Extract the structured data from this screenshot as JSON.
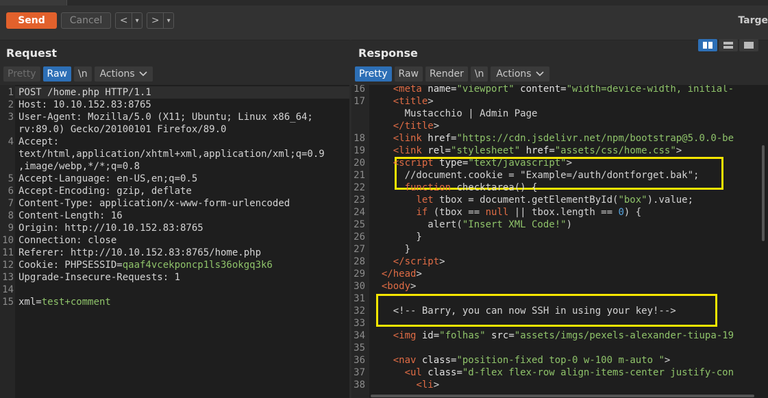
{
  "toolbar": {
    "send_label": "Send",
    "cancel_label": "Cancel",
    "back_glyph": "<",
    "forward_glyph": ">",
    "dropdown_glyph": "▾",
    "target_label": "Targe"
  },
  "request": {
    "title": "Request",
    "tabs": [
      {
        "label": "Pretty",
        "state": "disabled"
      },
      {
        "label": "Raw",
        "state": "selected"
      },
      {
        "label": "\\n",
        "state": "normal"
      },
      {
        "label": "Actions",
        "state": "dropdown"
      }
    ],
    "lines": [
      {
        "num": "1",
        "parts": [
          [
            "plain",
            "POST /home.php HTTP/1.1"
          ]
        ]
      },
      {
        "num": "2",
        "parts": [
          [
            "plain",
            "Host: 10.10.152.83:8765"
          ]
        ]
      },
      {
        "num": "3",
        "parts": [
          [
            "plain",
            "User-Agent: Mozilla/5.0 (X11; Ubuntu; Linux x86_64;"
          ]
        ]
      },
      {
        "num": "",
        "parts": [
          [
            "plain",
            "rv:89.0) Gecko/20100101 Firefox/89.0"
          ]
        ]
      },
      {
        "num": "4",
        "parts": [
          [
            "plain",
            "Accept:"
          ]
        ]
      },
      {
        "num": "",
        "parts": [
          [
            "plain",
            "text/html,application/xhtml+xml,application/xml;q=0.9"
          ]
        ]
      },
      {
        "num": "",
        "parts": [
          [
            "plain",
            ",image/webp,*/*;q=0.8"
          ]
        ]
      },
      {
        "num": "5",
        "parts": [
          [
            "plain",
            "Accept-Language: en-US,en;q=0.5"
          ]
        ]
      },
      {
        "num": "6",
        "parts": [
          [
            "plain",
            "Accept-Encoding: gzip, deflate"
          ]
        ]
      },
      {
        "num": "7",
        "parts": [
          [
            "plain",
            "Content-Type: application/x-www-form-urlencoded"
          ]
        ]
      },
      {
        "num": "8",
        "parts": [
          [
            "plain",
            "Content-Length: 16"
          ]
        ]
      },
      {
        "num": "9",
        "parts": [
          [
            "plain",
            "Origin: http://10.10.152.83:8765"
          ]
        ]
      },
      {
        "num": "10",
        "parts": [
          [
            "plain",
            "Connection: close"
          ]
        ]
      },
      {
        "num": "11",
        "parts": [
          [
            "plain",
            "Referer: http://10.10.152.83:8765/home.php"
          ]
        ]
      },
      {
        "num": "12",
        "parts": [
          [
            "plain",
            "Cookie: PHPSESSID="
          ],
          [
            "val",
            "qaaf4vcekponcp1ls36okgq3k6"
          ]
        ]
      },
      {
        "num": "13",
        "parts": [
          [
            "plain",
            "Upgrade-Insecure-Requests: 1"
          ]
        ]
      },
      {
        "num": "14",
        "parts": [
          [
            "plain",
            ""
          ]
        ]
      },
      {
        "num": "15",
        "parts": [
          [
            "plain",
            "xml="
          ],
          [
            "val",
            "test+comment"
          ]
        ]
      }
    ]
  },
  "response": {
    "title": "Response",
    "tabs": [
      {
        "label": "Pretty",
        "state": "selected"
      },
      {
        "label": "Raw",
        "state": "normal"
      },
      {
        "label": "Render",
        "state": "normal"
      },
      {
        "label": "\\n",
        "state": "normal"
      },
      {
        "label": "Actions",
        "state": "dropdown"
      }
    ],
    "lines": [
      {
        "num": "16",
        "parts": [
          [
            "plain",
            "    "
          ],
          [
            "tag",
            "<meta "
          ],
          [
            "attr",
            "name="
          ],
          [
            "str",
            "\"viewport\""
          ],
          [
            "attr",
            " content="
          ],
          [
            "str",
            "\"width=device-width, initial-"
          ]
        ]
      },
      {
        "num": "17",
        "parts": [
          [
            "plain",
            "    "
          ],
          [
            "tag",
            "<title"
          ],
          [
            "plain",
            ">"
          ]
        ]
      },
      {
        "num": "",
        "parts": [
          [
            "plain",
            "      Mustacchio | Admin Page"
          ]
        ]
      },
      {
        "num": "",
        "parts": [
          [
            "plain",
            "    "
          ],
          [
            "tag",
            "</title"
          ],
          [
            "plain",
            ">"
          ]
        ]
      },
      {
        "num": "18",
        "parts": [
          [
            "plain",
            "    "
          ],
          [
            "tag",
            "<link "
          ],
          [
            "attr",
            "href="
          ],
          [
            "str",
            "\"https://cdn.jsdelivr.net/npm/bootstrap@5.0.0-be"
          ]
        ]
      },
      {
        "num": "19",
        "parts": [
          [
            "plain",
            "    "
          ],
          [
            "tag",
            "<link "
          ],
          [
            "attr",
            "rel="
          ],
          [
            "str",
            "\"stylesheet\""
          ],
          [
            "attr",
            " href="
          ],
          [
            "str",
            "\"assets/css/home.css\""
          ],
          [
            "plain",
            ">"
          ]
        ]
      },
      {
        "num": "20",
        "parts": [
          [
            "plain",
            "    "
          ],
          [
            "tag",
            "<script "
          ],
          [
            "attr",
            "type="
          ],
          [
            "str",
            "\"text/javascript\""
          ],
          [
            "plain",
            ">"
          ]
        ]
      },
      {
        "num": "21",
        "parts": [
          [
            "plain",
            "      //document.cookie = \"Example=/auth/dontforget.bak\";"
          ]
        ]
      },
      {
        "num": "22",
        "parts": [
          [
            "plain",
            "      "
          ],
          [
            "kw",
            "function"
          ],
          [
            "plain",
            " checktarea() {"
          ]
        ]
      },
      {
        "num": "23",
        "parts": [
          [
            "plain",
            "        "
          ],
          [
            "kw",
            "let"
          ],
          [
            "plain",
            " tbox = document.getElementById("
          ],
          [
            "str",
            "\"box\""
          ],
          [
            "plain",
            ").value;"
          ]
        ]
      },
      {
        "num": "24",
        "parts": [
          [
            "plain",
            "        "
          ],
          [
            "kw",
            "if"
          ],
          [
            "plain",
            " (tbox == "
          ],
          [
            "kw",
            "null"
          ],
          [
            "plain",
            " || tbox.length == "
          ],
          [
            "num",
            "0"
          ],
          [
            "plain",
            ") {"
          ]
        ]
      },
      {
        "num": "25",
        "parts": [
          [
            "plain",
            "          alert("
          ],
          [
            "str",
            "\"Insert XML Code!\""
          ],
          [
            "plain",
            ")"
          ]
        ]
      },
      {
        "num": "26",
        "parts": [
          [
            "plain",
            "        }"
          ]
        ]
      },
      {
        "num": "27",
        "parts": [
          [
            "plain",
            "      }"
          ]
        ]
      },
      {
        "num": "28",
        "parts": [
          [
            "plain",
            "    "
          ],
          [
            "tag",
            "</script"
          ],
          [
            "plain",
            ">"
          ]
        ]
      },
      {
        "num": "29",
        "parts": [
          [
            "plain",
            "  "
          ],
          [
            "tag",
            "</head"
          ],
          [
            "plain",
            ">"
          ]
        ]
      },
      {
        "num": "30",
        "parts": [
          [
            "plain",
            "  "
          ],
          [
            "tag",
            "<body"
          ],
          [
            "plain",
            ">"
          ]
        ]
      },
      {
        "num": "31",
        "parts": [
          [
            "plain",
            ""
          ]
        ]
      },
      {
        "num": "32",
        "parts": [
          [
            "plain",
            "    <!-- Barry, you can now SSH in using your key!-->"
          ]
        ]
      },
      {
        "num": "33",
        "parts": [
          [
            "plain",
            ""
          ]
        ]
      },
      {
        "num": "34",
        "parts": [
          [
            "plain",
            "    "
          ],
          [
            "tag",
            "<img "
          ],
          [
            "attr",
            "id="
          ],
          [
            "str",
            "\"folhas\""
          ],
          [
            "attr",
            " src="
          ],
          [
            "str",
            "\"assets/imgs/pexels-alexander-tiupa-19"
          ]
        ]
      },
      {
        "num": "35",
        "parts": [
          [
            "plain",
            ""
          ]
        ]
      },
      {
        "num": "36",
        "parts": [
          [
            "plain",
            "    "
          ],
          [
            "tag",
            "<nav "
          ],
          [
            "attr",
            "class="
          ],
          [
            "str",
            "\"position-fixed top-0 w-100 m-auto \""
          ],
          [
            "plain",
            ">"
          ]
        ]
      },
      {
        "num": "37",
        "parts": [
          [
            "plain",
            "      "
          ],
          [
            "tag",
            "<ul "
          ],
          [
            "attr",
            "class="
          ],
          [
            "str",
            "\"d-flex flex-row align-items-center justify-con"
          ]
        ]
      },
      {
        "num": "38",
        "parts": [
          [
            "plain",
            "        "
          ],
          [
            "tag",
            "<li"
          ],
          [
            "plain",
            ">"
          ]
        ]
      }
    ]
  },
  "colors": {
    "accent_send": "#e2612c",
    "selected_tab": "#2d6fb6",
    "highlight_box": "#f5e600"
  }
}
